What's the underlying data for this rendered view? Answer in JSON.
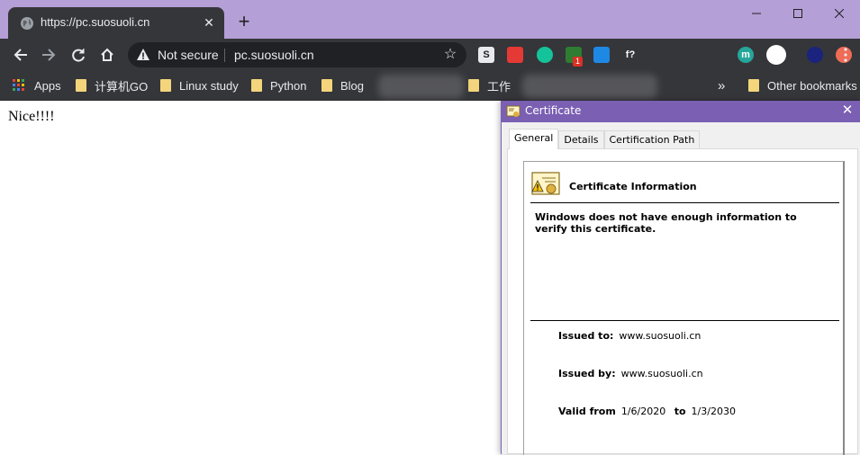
{
  "browser": {
    "tab": {
      "title": "https://pc.suosuoli.cn",
      "close": "✕"
    },
    "new_tab": "+",
    "omnibox": {
      "security": "Not secure",
      "url": "pc.suosuoli.cn"
    },
    "extensions": [
      {
        "name": "S",
        "color": "#5f6368"
      },
      {
        "name": "",
        "color": "#e53935"
      },
      {
        "name": "",
        "color": "#15c39a"
      },
      {
        "name": "",
        "color": "#2e7d32",
        "badge": "1"
      },
      {
        "name": "",
        "color": "#1e88e5"
      },
      {
        "name": "f?",
        "color": "#35363a"
      },
      {
        "name": "",
        "color": "#35363a"
      },
      {
        "name": "",
        "color": "#35363a"
      },
      {
        "name": "",
        "color": "#35363a"
      },
      {
        "name": "m",
        "color": "#26a69a"
      },
      {
        "name": "",
        "color": "#fff"
      },
      {
        "name": "",
        "color": "#1a237e"
      },
      {
        "name": "",
        "color": "#ef6c57"
      }
    ],
    "bookmarks": {
      "apps": "Apps",
      "items": [
        "计算机GO",
        "Linux study",
        "Python",
        "Blog",
        "工作"
      ],
      "overflow": "»",
      "other": "Other bookmarks"
    }
  },
  "page": {
    "text": "Nice!!!!"
  },
  "dialog": {
    "title": "Certificate",
    "close": "✕",
    "tabs": [
      "General",
      "Details",
      "Certification Path"
    ],
    "info_title": "Certificate Information",
    "warning": "Windows does not have enough information to verify this certificate.",
    "issued_to_label": "Issued to:",
    "issued_to": "www.suosuoli.cn",
    "issued_by_label": "Issued by:",
    "issued_by": "www.suosuoli.cn",
    "valid_from_label": "Valid from",
    "valid_from": "1/6/2020",
    "to_label": "to",
    "valid_to": "1/3/2030"
  }
}
